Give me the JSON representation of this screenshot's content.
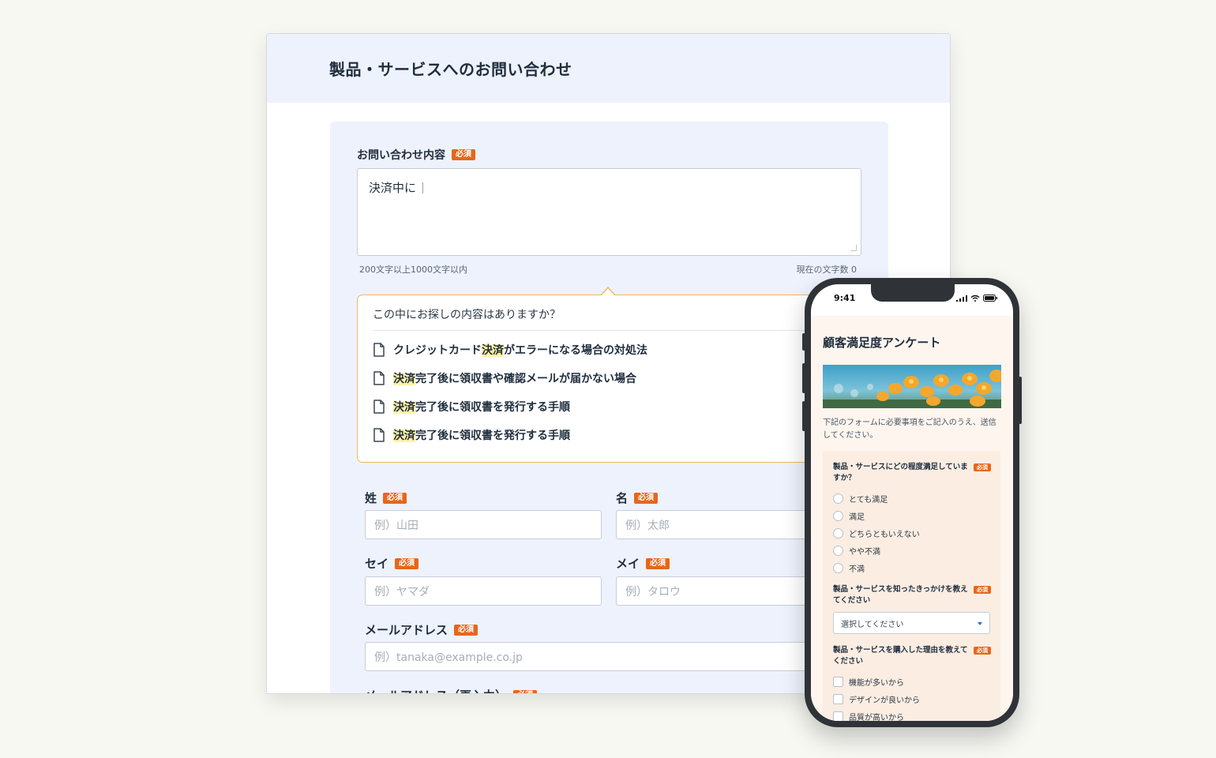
{
  "desktop": {
    "title": "製品・サービスへのお問い合わせ",
    "required": "必須",
    "inquiry": {
      "label": "お問い合わせ内容",
      "value": "決済中に",
      "hint_left": "200文字以上1000文字以内",
      "hint_right": "現在の文字数 0"
    },
    "suggest": {
      "question": "この中にお探しの内容はありますか？",
      "items": [
        {
          "before": "クレジットカード",
          "highlight": "決済",
          "after": "がエラーになる場合の対処法"
        },
        {
          "before": "",
          "highlight": "決済",
          "after": "完了後に領収書や確認メールが届かない場合"
        },
        {
          "before": "",
          "highlight": "決済",
          "after": "完了後に領収書を発行する手順"
        },
        {
          "before": "",
          "highlight": "決済",
          "after": "完了後に領収書を発行する手順"
        }
      ]
    },
    "fields": {
      "sei_label": "姓",
      "sei_placeholder": "例）山田",
      "mei_label": "名",
      "mei_placeholder": "例）太郎",
      "sei_kana_label": "セイ",
      "sei_kana_placeholder": "例）ヤマダ",
      "mei_kana_label": "メイ",
      "mei_kana_placeholder": "例）タロウ",
      "email_label": "メールアドレス",
      "email_placeholder": "例）tanaka@example.co.jp",
      "email_confirm_label": "メールアドレス（再入力）"
    }
  },
  "phone": {
    "time": "9:41",
    "title": "顧客満足度アンケート",
    "description": "下記のフォームに必要事項をご記入のうえ、送信してください。",
    "required": "必須",
    "q1": {
      "label": "製品・サービスにどの程度満足していますか？",
      "options": [
        "とても満足",
        "満足",
        "どちらともいえない",
        "やや不満",
        "不満"
      ]
    },
    "q2": {
      "label": "製品・サービスを知ったきっかけを教えてください",
      "select_value": "選択してください"
    },
    "q3": {
      "label": "製品・サービスを購入した理由を教えてください",
      "options": [
        "機能が多いから",
        "デザインが良いから",
        "品質が高いから"
      ]
    }
  }
}
